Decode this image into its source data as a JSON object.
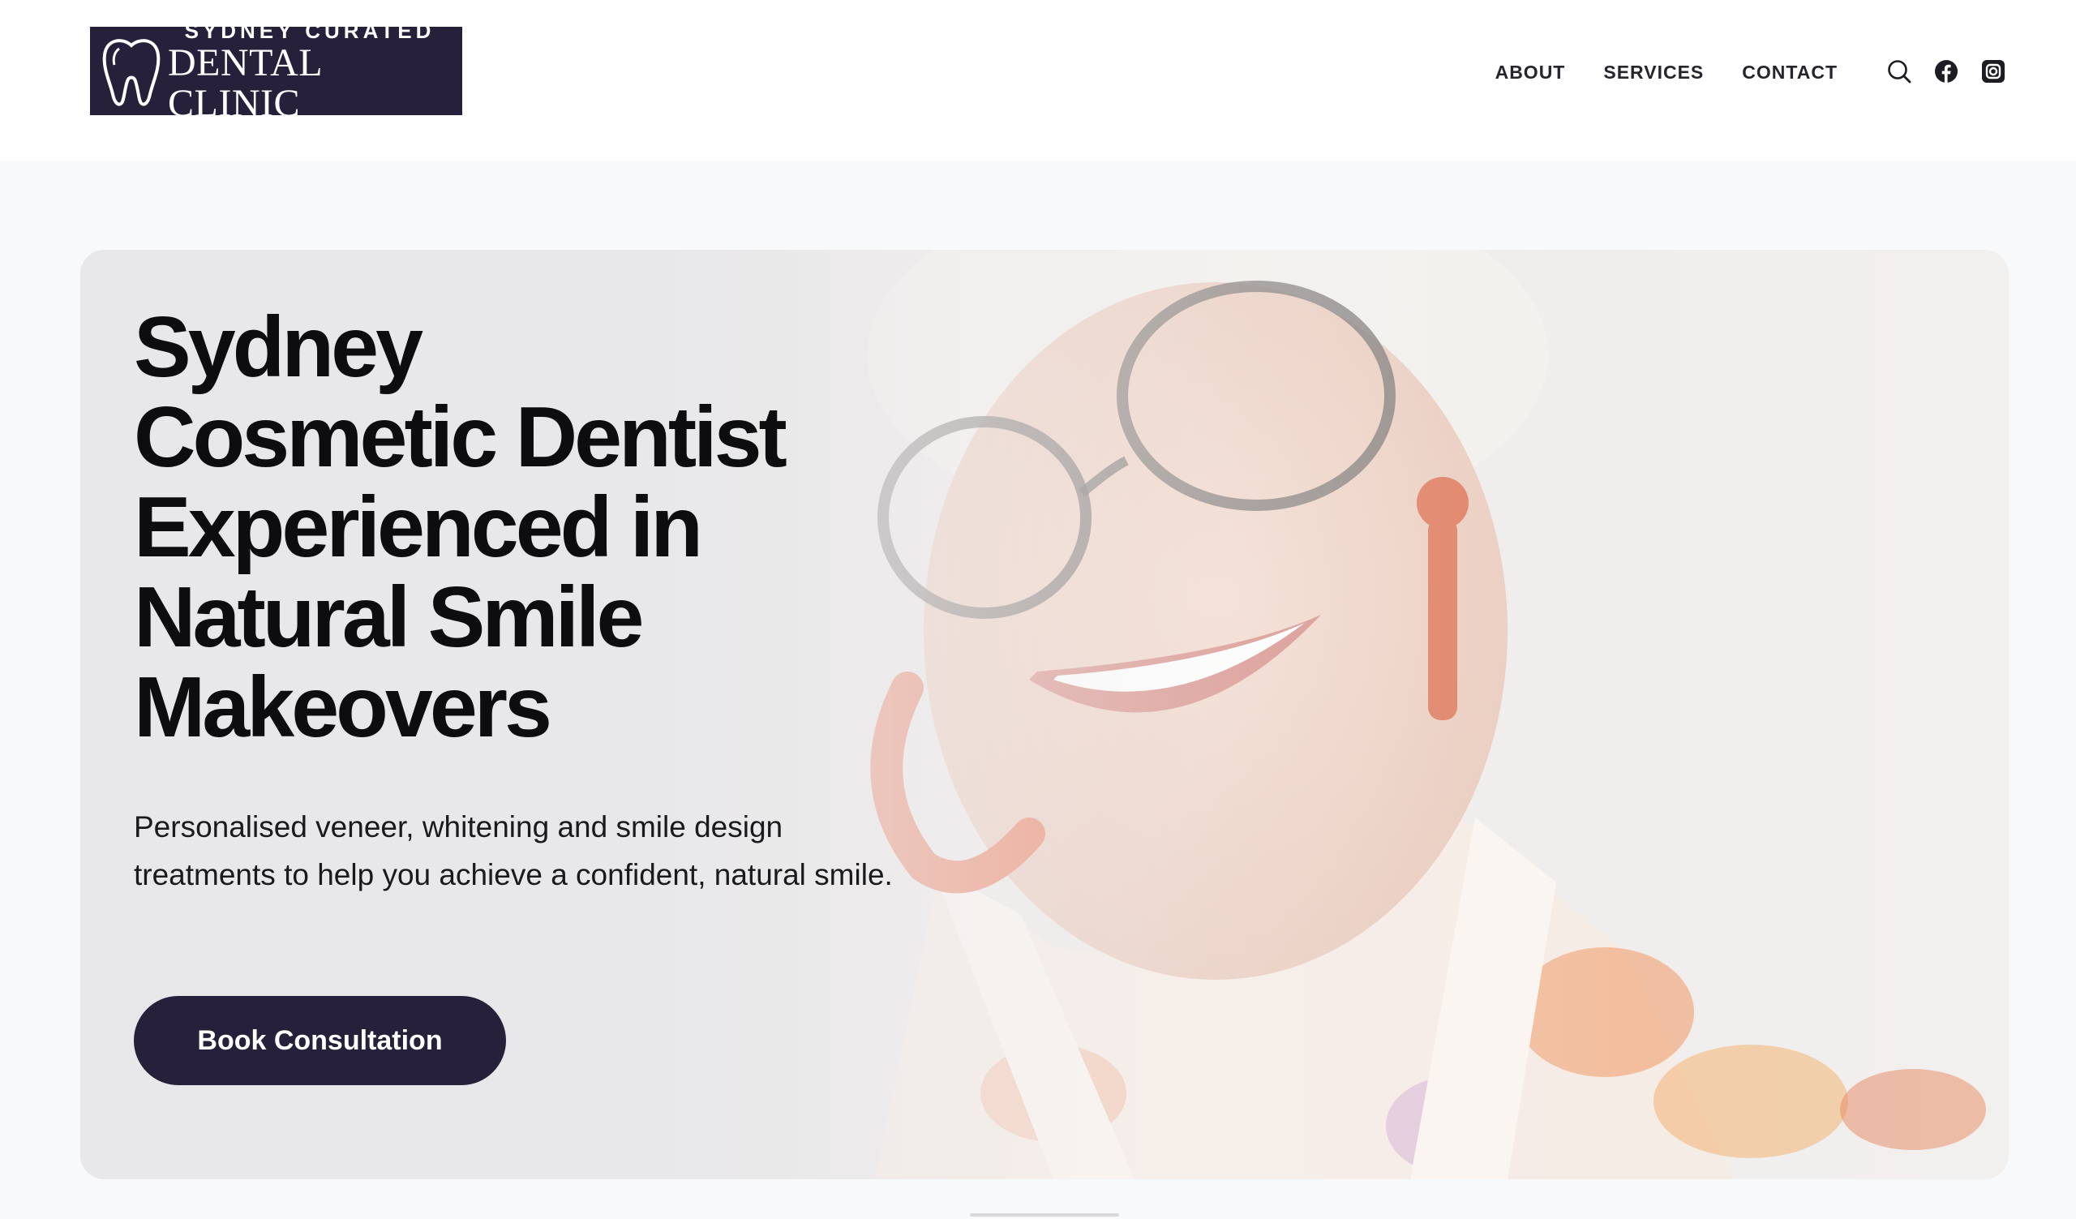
{
  "header": {
    "logo": {
      "line1": "SYDNEY CURATED",
      "line2": "DENTAL CLINIC",
      "icon": "tooth-icon"
    },
    "nav": [
      {
        "label": "ABOUT"
      },
      {
        "label": "SERVICES"
      },
      {
        "label": "CONTACT"
      }
    ],
    "icons": [
      "search-icon",
      "facebook-icon",
      "instagram-icon"
    ]
  },
  "hero": {
    "title": "Sydney\nCosmetic Dentist\nExperienced in\nNatural Smile\nMakeovers",
    "subtitle": "Personalised veneer, whitening and smile design treatments to help you achieve a confident, natural smile.",
    "cta_label": "Book Consultation",
    "image": "smiling-woman-with-glasses-photo"
  },
  "colors": {
    "brand": "#26203a",
    "text": "#0d0d10",
    "header_bg": "#ffffff",
    "page_bg": "#f8f9fa"
  }
}
